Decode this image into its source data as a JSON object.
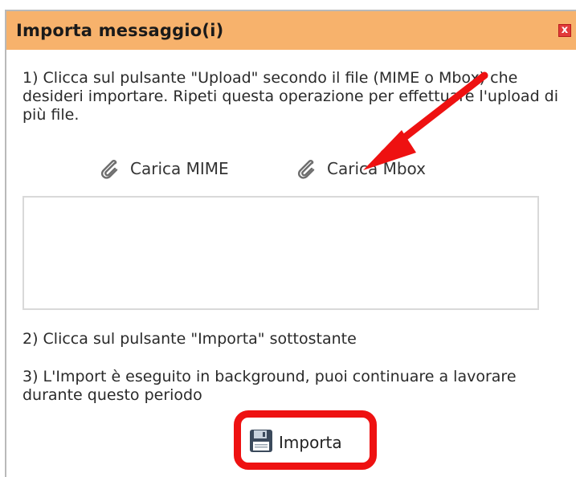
{
  "dialog": {
    "title": "Importa messaggio(i)",
    "close_symbol": "x"
  },
  "steps": {
    "step1": "1) Clicca sul pulsante \"Upload\" secondo il file (MIME o Mbox) che desideri importare. Ripeti questa operazione per effettuare l'upload di più file.",
    "step2": "2) Clicca sul pulsante \"Importa\" sottostante",
    "step3": "3) L'Import è eseguito in background, puoi continuare a lavorare durante questo periodo"
  },
  "upload": {
    "mime_label": "Carica MIME",
    "mbox_label": "Carica Mbox",
    "icon": "paperclip-icon"
  },
  "import": {
    "label": "Importa",
    "icon": "floppy-disk-icon"
  },
  "colors": {
    "titlebar": "#f7b26c",
    "highlight": "#ee1111",
    "arrow": "#ee1111"
  }
}
